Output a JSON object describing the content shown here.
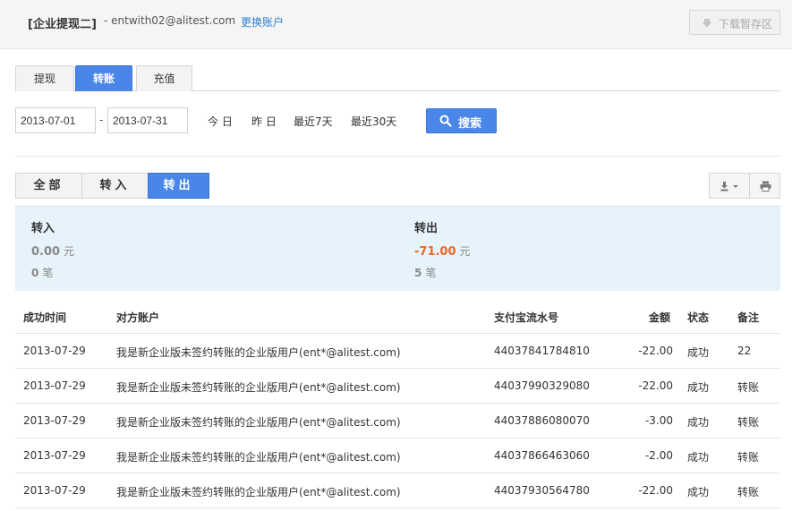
{
  "header": {
    "title": "[企业提现二]",
    "email": "- entwith02@alitest.com",
    "switch_account": "更换账户",
    "download_label": "下载暂存区"
  },
  "tabs": [
    {
      "label": "提现",
      "active": false
    },
    {
      "label": "转账",
      "active": true
    },
    {
      "label": "充值",
      "active": false
    }
  ],
  "filter": {
    "start_date": "2013-07-01",
    "separator": "-",
    "end_date": "2013-07-31",
    "quick_ranges": [
      "今 日",
      "昨 日",
      "最近7天",
      "最近30天"
    ],
    "search_label": "搜索"
  },
  "segments": [
    {
      "label": "全部",
      "active": false
    },
    {
      "label": "转入",
      "active": false
    },
    {
      "label": "转出",
      "active": true
    }
  ],
  "summary": {
    "in": {
      "label": "转入",
      "amount": "0.00",
      "amount_unit": "元",
      "count": "0",
      "count_unit": "笔"
    },
    "out": {
      "label": "转出",
      "amount": "-71.00",
      "amount_unit": "元",
      "count": "5",
      "count_unit": "笔"
    }
  },
  "colors": {
    "accent": "#4a86e8",
    "negative_amount": "#f26522",
    "link": "#2e7fd1",
    "summary_bg": "#e6f3fb"
  },
  "table": {
    "columns": [
      "成功时间",
      "对方账户",
      "支付宝流水号",
      "金额",
      "状态",
      "备注"
    ],
    "rows": [
      [
        "2013-07-29",
        "我是新企业版未签约转账的企业版用户(ent*@alitest.com)",
        "44037841784810",
        "-22.00",
        "成功",
        "22"
      ],
      [
        "2013-07-29",
        "我是新企业版未签约转账的企业版用户(ent*@alitest.com)",
        "44037990329080",
        "-22.00",
        "成功",
        "转账"
      ],
      [
        "2013-07-29",
        "我是新企业版未签约转账的企业版用户(ent*@alitest.com)",
        "44037886080070",
        "-3.00",
        "成功",
        "转账"
      ],
      [
        "2013-07-29",
        "我是新企业版未签约转账的企业版用户(ent*@alitest.com)",
        "44037866463060",
        "-2.00",
        "成功",
        "转账"
      ],
      [
        "2013-07-29",
        "我是新企业版未签约转账的企业版用户(ent*@alitest.com)",
        "44037930564780",
        "-22.00",
        "成功",
        "转账"
      ]
    ]
  }
}
